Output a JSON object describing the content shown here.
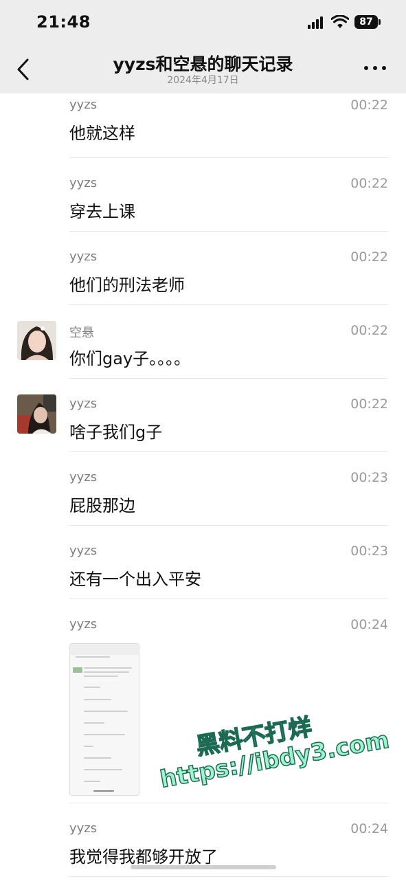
{
  "status": {
    "time": "21:48",
    "battery": "87"
  },
  "header": {
    "title": "yyzs和空悬的聊天记录",
    "subtitle": "2024年4月17日"
  },
  "messages": [
    {
      "sender": "yyzs",
      "time": "00:22",
      "text": "他就这样"
    },
    {
      "sender": "yyzs",
      "time": "00:22",
      "text": "穿去上课"
    },
    {
      "sender": "yyzs",
      "time": "00:22",
      "text": "他们的刑法老师"
    },
    {
      "sender": "空悬",
      "time": "00:22",
      "text": "你们gay子。。。。"
    },
    {
      "sender": "yyzs",
      "time": "00:22",
      "text": "啥子我们g子"
    },
    {
      "sender": "yyzs",
      "time": "00:23",
      "text": "屁股那边"
    },
    {
      "sender": "yyzs",
      "time": "00:23",
      "text": "还有一个出入平安"
    },
    {
      "sender": "yyzs",
      "time": "00:24",
      "text": ""
    },
    {
      "sender": "yyzs",
      "time": "00:24",
      "text": "我觉得我都够开放了"
    }
  ],
  "watermark": {
    "line1": "黑料不打烊",
    "line2": "https://ibdy3.com"
  }
}
